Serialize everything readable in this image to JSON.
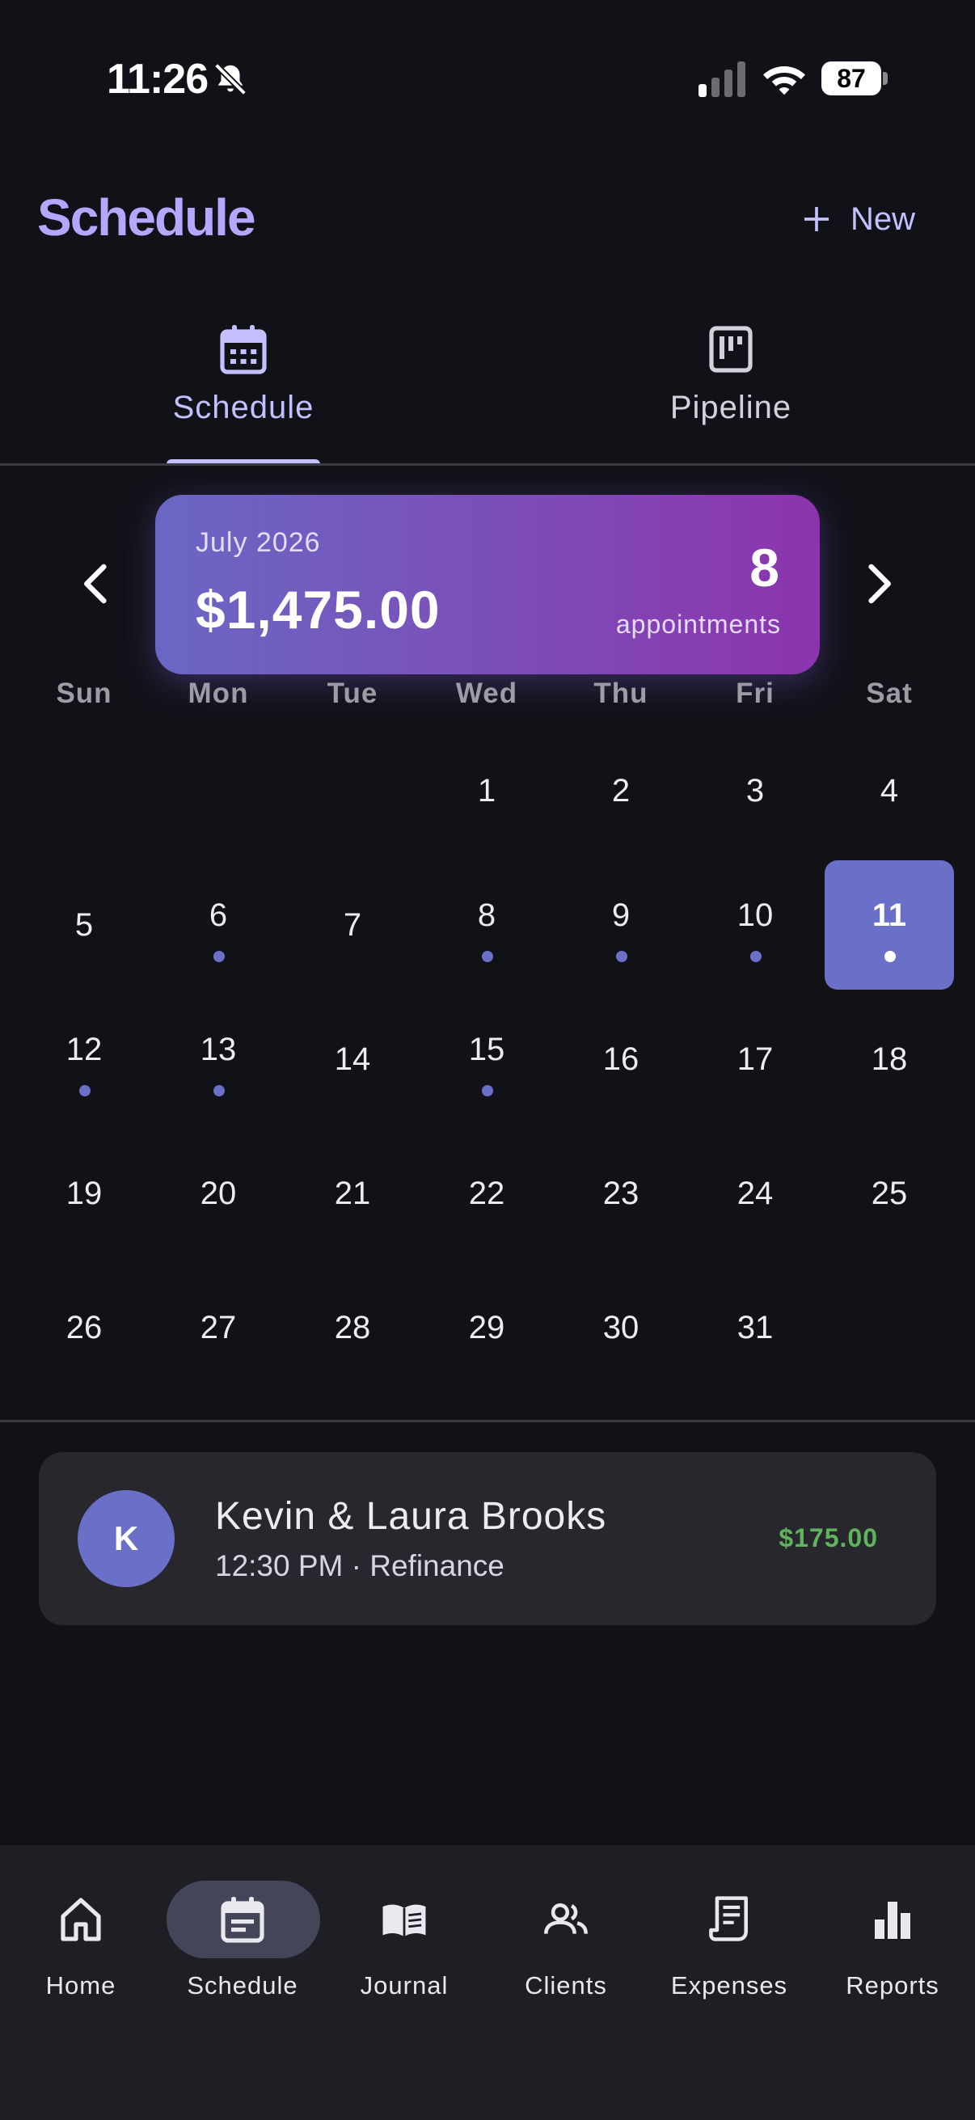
{
  "status_bar": {
    "time": "11:26",
    "battery": "87",
    "icons": [
      "bell-slash-icon",
      "signal-icon",
      "wifi-icon",
      "battery-icon"
    ]
  },
  "header": {
    "title": "Schedule",
    "new_label": "New",
    "new_icon": "plus-icon"
  },
  "tabs": [
    {
      "label": "Schedule",
      "icon": "calendar-icon",
      "active": true
    },
    {
      "label": "Pipeline",
      "icon": "kanban-icon",
      "active": false
    }
  ],
  "summary": {
    "month": "July 2026",
    "total": "$1,475.00",
    "count": "8",
    "count_label": "appointments"
  },
  "calendar": {
    "weekdays": [
      "Sun",
      "Mon",
      "Tue",
      "Wed",
      "Thu",
      "Fri",
      "Sat"
    ],
    "first_weekday_index": 3,
    "days_in_month": 31,
    "selected_day": 11,
    "days_with_appointments": [
      6,
      8,
      9,
      10,
      11,
      12,
      13,
      15
    ]
  },
  "appointments": [
    {
      "initial": "K",
      "name": "Kevin & Laura Brooks",
      "detail": "12:30 PM · Refinance",
      "amount": "$175.00"
    }
  ],
  "bottom_nav": [
    {
      "label": "Home",
      "icon": "home-icon",
      "active": false
    },
    {
      "label": "Schedule",
      "icon": "calendar-note-icon",
      "active": true
    },
    {
      "label": "Journal",
      "icon": "book-icon",
      "active": false
    },
    {
      "label": "Clients",
      "icon": "people-icon",
      "active": false
    },
    {
      "label": "Expenses",
      "icon": "receipt-icon",
      "active": false
    },
    {
      "label": "Reports",
      "icon": "bar-chart-icon",
      "active": false
    }
  ],
  "colors": {
    "background": "#111218",
    "accent": "#6a6fc8",
    "title": "#b5a6ff",
    "amount_green": "#5fb35a",
    "card_gradient_start": "#6a67c4",
    "card_gradient_end": "#8c34ae"
  }
}
